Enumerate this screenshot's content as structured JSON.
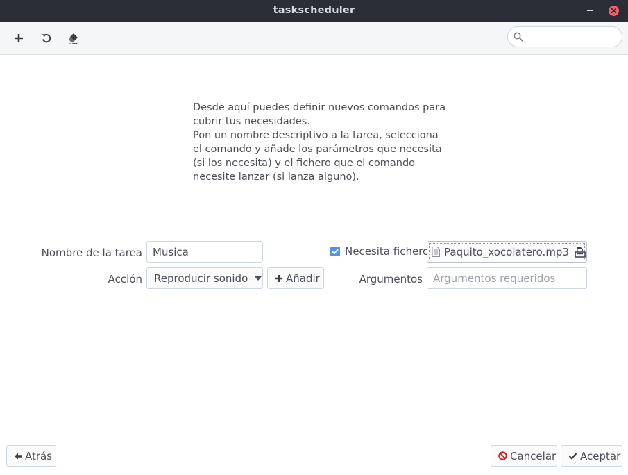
{
  "window": {
    "title": "taskscheduler"
  },
  "toolbar": {
    "add_icon": "plus-icon",
    "refresh_icon": "undo-icon",
    "clear_icon": "eraser-icon",
    "search": {
      "placeholder": "",
      "value": ""
    }
  },
  "description": {
    "line1": "Desde aquí puedes definir nuevos comandos para cubrir tus necesidades.",
    "line2": "Pon un nombre descriptivo a la tarea, selecciona el comando y añade los parámetros que necesita (si los necesita) y el fichero que el comando necesite lanzar (si lanza alguno)."
  },
  "form": {
    "task_name_label": "Nombre de la tarea",
    "task_name_value": "Musica",
    "action_label": "Acción",
    "action_selected": "Reproducir sonido",
    "add_button_label": "Añadir",
    "needs_file_label": "Necesita fichero",
    "needs_file_checked": true,
    "file_name": "Paquito_xocolatero.mp3",
    "arguments_label": "Argumentos",
    "arguments_placeholder": "Argumentos requeridos",
    "arguments_value": ""
  },
  "footer": {
    "back_label": "Atrás",
    "cancel_label": "Cancelar",
    "accept_label": "Aceptar"
  },
  "colors": {
    "titlebar": "#2b2e37",
    "accent": "#5294e2",
    "close": "#f46067",
    "cancel_icon": "#cc2222"
  }
}
